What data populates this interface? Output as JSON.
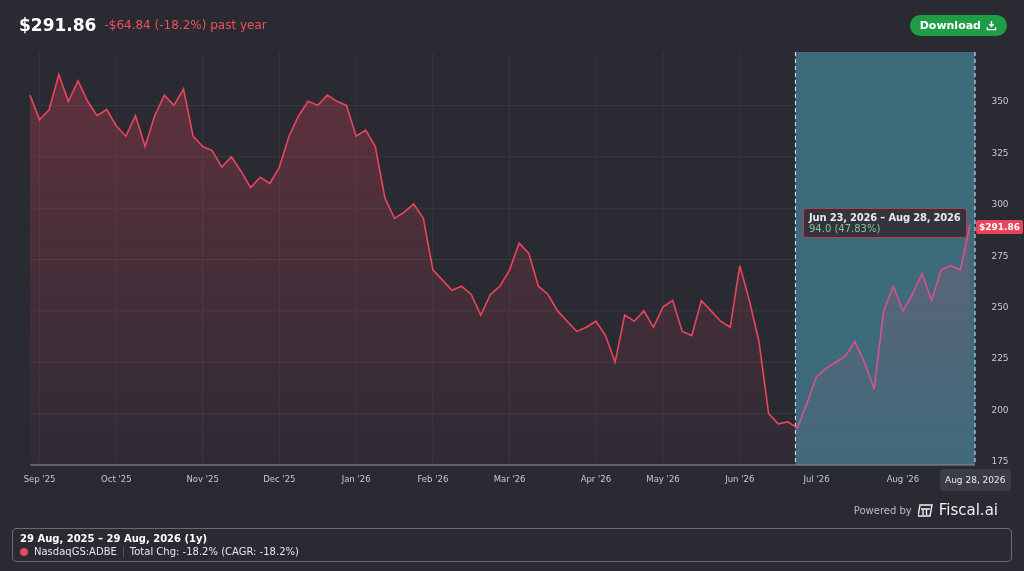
{
  "header": {
    "price": "$291.86",
    "change": "-$64.84 (-18.2%) past year",
    "download_button": "Download"
  },
  "chart": {
    "chart_data": {
      "type": "area",
      "categories": [
        null,
        "Sep '25",
        null,
        null,
        null,
        null,
        null,
        null,
        null,
        "Oct '25",
        null,
        null,
        null,
        null,
        null,
        null,
        null,
        null,
        "Nov '25",
        null,
        null,
        null,
        null,
        null,
        null,
        null,
        "Dec '25",
        null,
        null,
        null,
        null,
        null,
        null,
        null,
        "Jan '26",
        null,
        null,
        null,
        null,
        null,
        null,
        null,
        "Feb '26",
        null,
        null,
        null,
        null,
        null,
        null,
        null,
        "Mar '26",
        null,
        null,
        null,
        null,
        null,
        null,
        null,
        null,
        "Apr '26",
        null,
        null,
        null,
        null,
        null,
        null,
        "May '26",
        null,
        null,
        null,
        null,
        null,
        null,
        null,
        "Jun '26",
        null,
        null,
        null,
        null,
        null,
        null,
        null,
        "Jul '26",
        null,
        null,
        null,
        null,
        null,
        null,
        null,
        null,
        "Aug '26",
        null,
        null,
        null,
        null,
        null,
        null,
        null
      ],
      "series": [
        {
          "name": "NasdaqGS:ADBE",
          "color": "#e8445a",
          "values": [
            355,
            343,
            348,
            365,
            352,
            362,
            352,
            345,
            348,
            340,
            335,
            345,
            330,
            345,
            355,
            350,
            358,
            335,
            330,
            328,
            320,
            325,
            318,
            310,
            315,
            312,
            320,
            335,
            345,
            352,
            350,
            355,
            352,
            350,
            335,
            338,
            330,
            305,
            295,
            298,
            302,
            295,
            270,
            265,
            260,
            262,
            258,
            248,
            258,
            262,
            270,
            283,
            278,
            262,
            258,
            250,
            245,
            240,
            242,
            245,
            238,
            225,
            248,
            245,
            250,
            242,
            252,
            255,
            240,
            238,
            255,
            250,
            245,
            242,
            272,
            255,
            235,
            200,
            195,
            196,
            193,
            205,
            218,
            222,
            225,
            228,
            235,
            225,
            212,
            250,
            262,
            250,
            258,
            268,
            255,
            270,
            272,
            270,
            292
          ]
        }
      ],
      "ylim": [
        175,
        376
      ],
      "grid": true,
      "yticks": [
        175,
        200,
        225,
        250,
        275,
        300,
        325,
        350
      ]
    },
    "highlight": {
      "level": 0.19
    },
    "tooltip": {
      "range": "Jun 23, 2026 – Aug 28, 2026",
      "change": "94.0 (47.83%)"
    },
    "price_tag": "$291.86",
    "date_tag": "Aug 28, 2026"
  },
  "powered_by": {
    "label": "Powered by",
    "brand": "Fiscal.ai"
  },
  "legend": {
    "period": "29 Aug, 2025 – 29 Aug, 2026 (1y)",
    "total_change": "Total Chg: -18.2% (CAGR: -18.2%)"
  }
}
